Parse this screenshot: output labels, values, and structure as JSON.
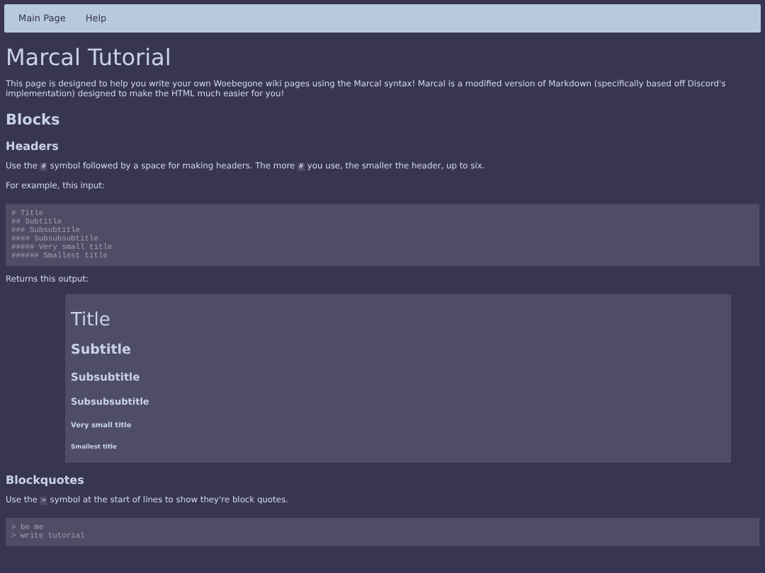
{
  "nav": [
    {
      "label": "Main Page"
    },
    {
      "label": "Help"
    }
  ],
  "content": [
    {
      "kind": "h1",
      "text": "Marcal Tutorial"
    },
    {
      "kind": "p",
      "parts": [
        {
          "kind": "text",
          "text": "This page is designed to help you write your own Woebegone wiki pages using the Marcal syntax! Marcal is a modified version of Markdown (specifically based off Discord's implementation) designed to make the HTML much easier for you!"
        }
      ]
    },
    {
      "kind": "h2",
      "text": "Blocks"
    },
    {
      "kind": "h3",
      "text": "Headers"
    },
    {
      "kind": "p",
      "parts": [
        {
          "kind": "text",
          "text": "Use the "
        },
        {
          "kind": "code",
          "text": "#"
        },
        {
          "kind": "text",
          "text": " symbol followed by a space for making headers. The more "
        },
        {
          "kind": "code",
          "text": "#"
        },
        {
          "kind": "text",
          "text": " you use, the smaller the header, up to six."
        }
      ]
    },
    {
      "kind": "p",
      "parts": [
        {
          "kind": "text",
          "text": "For example, this input:"
        }
      ]
    },
    {
      "kind": "code",
      "lines": [
        "# Title",
        "## Subtitle",
        "### Subsubtitle",
        "#### Subsubsubtitle",
        "##### Very small title",
        "###### Smallest title"
      ]
    },
    {
      "kind": "p",
      "parts": [
        {
          "kind": "text",
          "text": "Returns this output:"
        }
      ]
    },
    {
      "kind": "output",
      "headings": [
        {
          "kind": "h1",
          "text": "Title"
        },
        {
          "kind": "h2",
          "text": "Subtitle"
        },
        {
          "kind": "h3",
          "text": "Subsubtitle"
        },
        {
          "kind": "h4",
          "text": "Subsubsubtitle"
        },
        {
          "kind": "h5",
          "text": "Very small title"
        },
        {
          "kind": "h6",
          "text": "Smallest title"
        }
      ]
    },
    {
      "kind": "h3",
      "text": "Blockquotes"
    },
    {
      "kind": "p",
      "parts": [
        {
          "kind": "text",
          "text": "Use the "
        },
        {
          "kind": "code",
          "text": ">"
        },
        {
          "kind": "text",
          "text": " symbol at the start of lines to show they're block quotes."
        }
      ]
    },
    {
      "kind": "code",
      "lines": [
        "> be me",
        "> write tutorial"
      ]
    }
  ]
}
